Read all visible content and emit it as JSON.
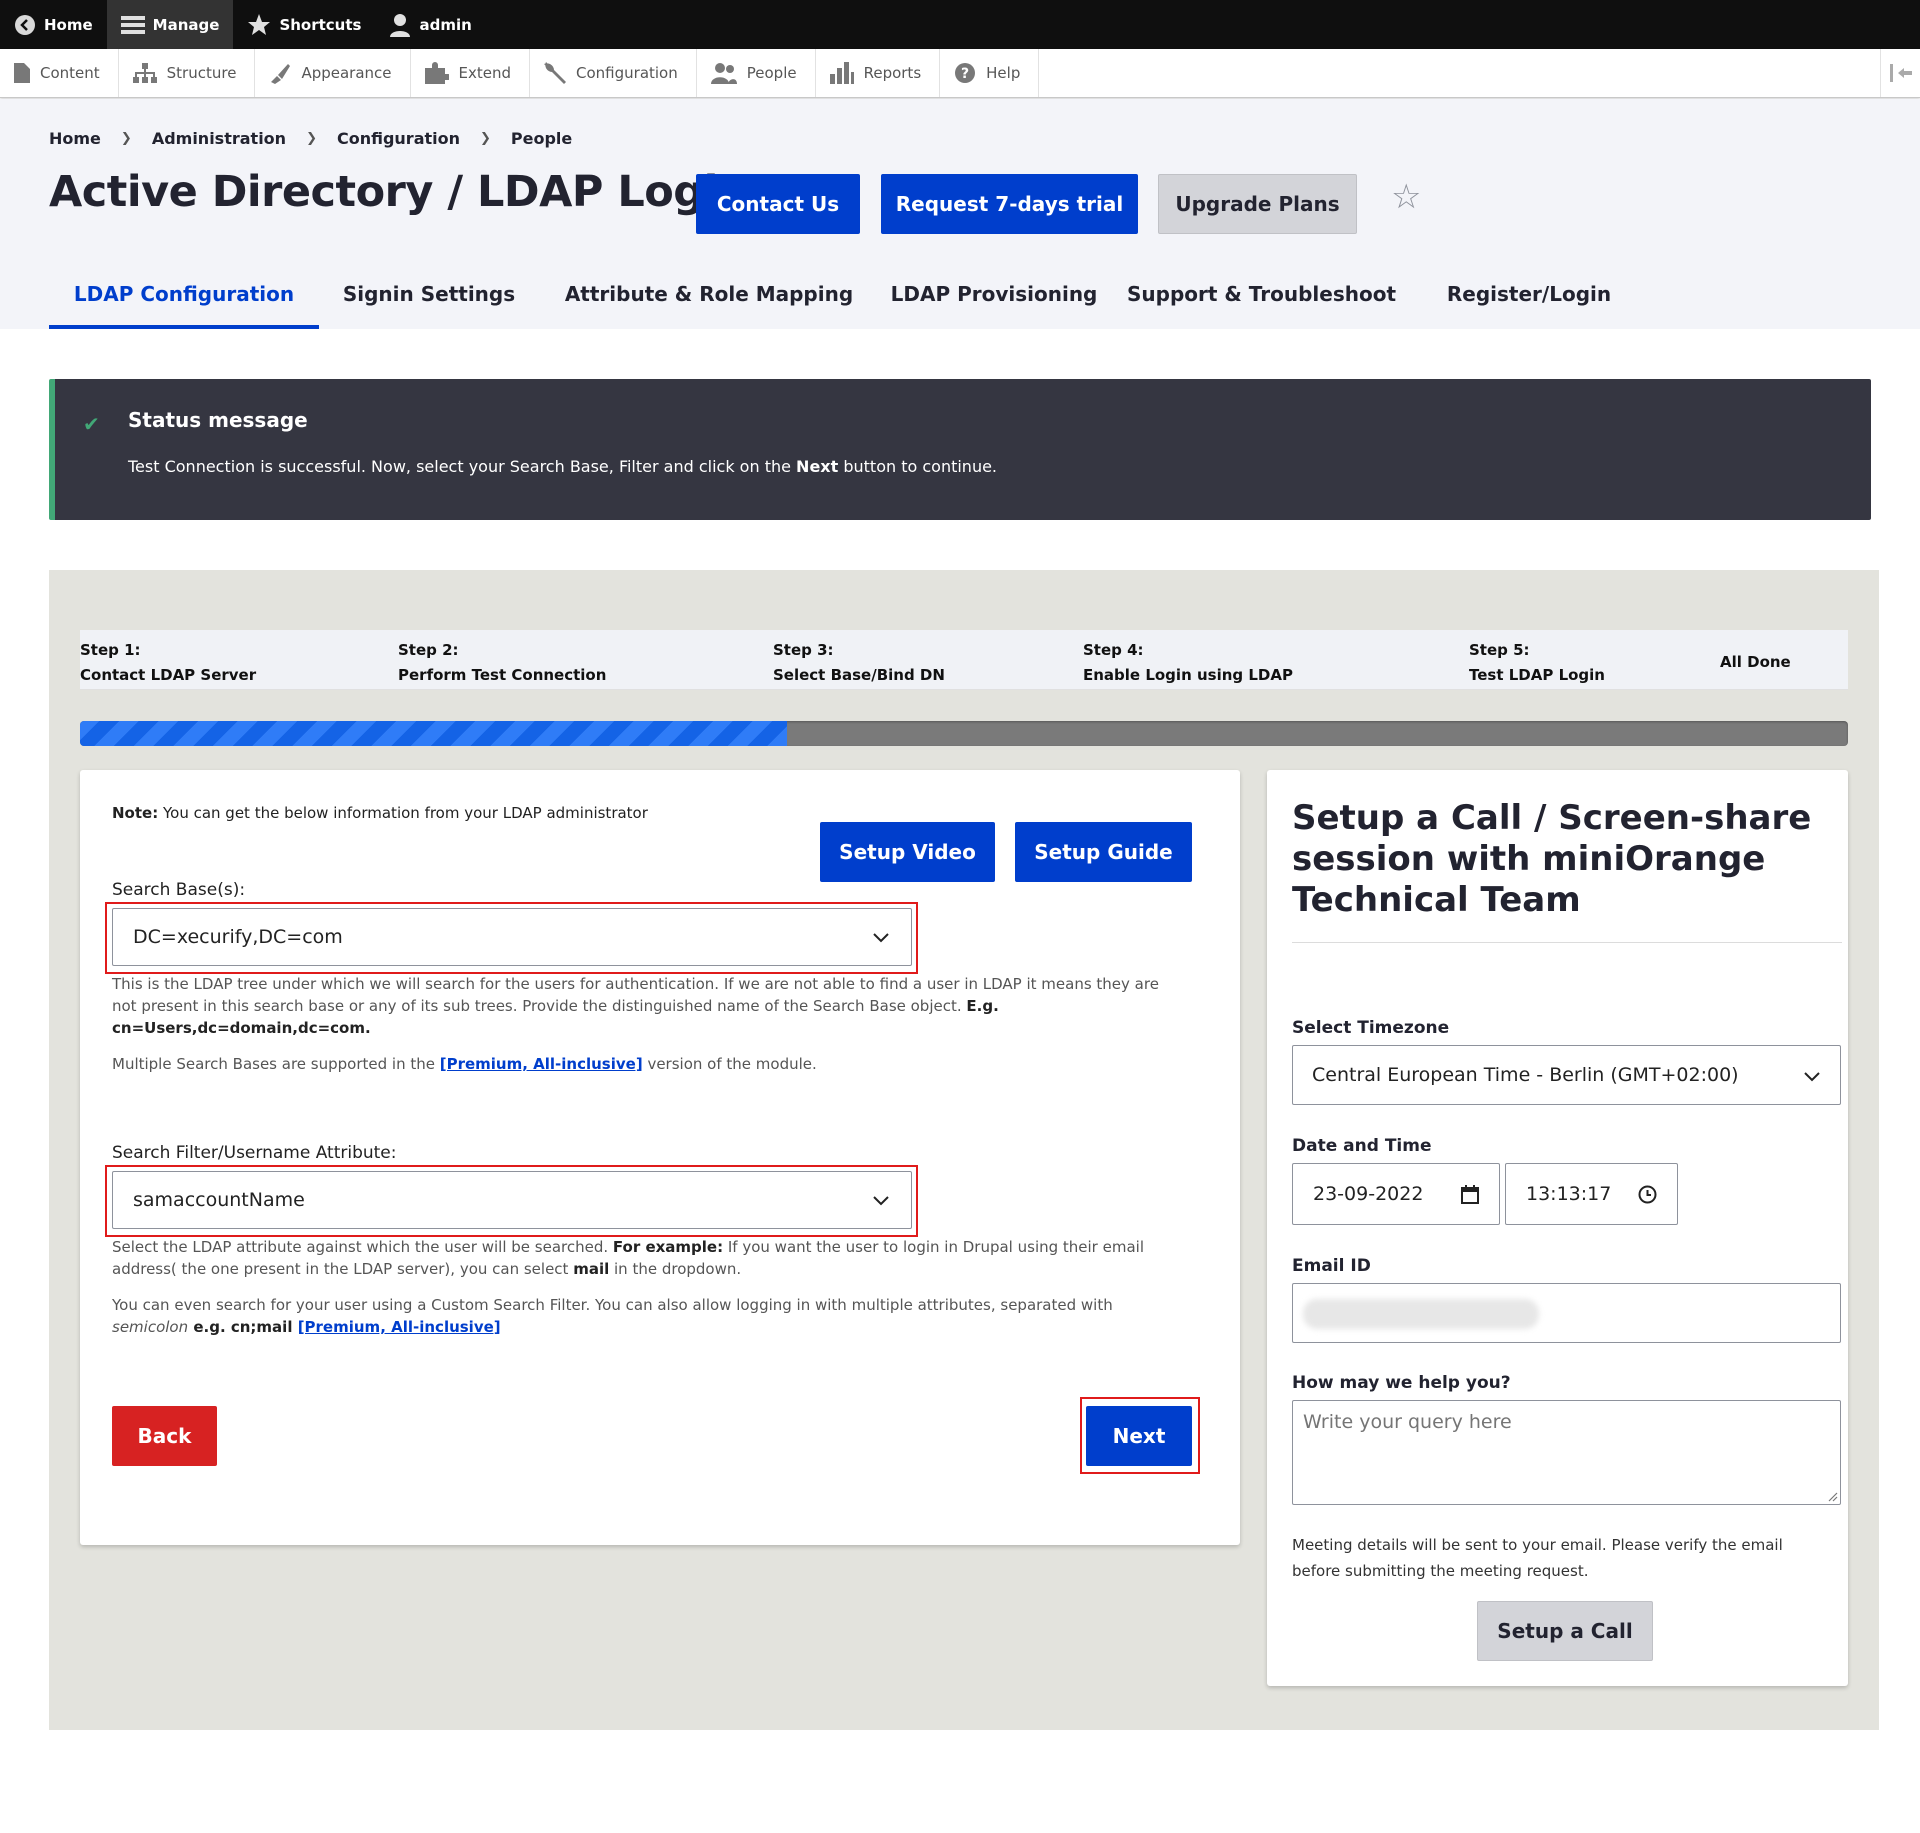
{
  "toolbar": {
    "home": "Home",
    "manage": "Manage",
    "shortcuts": "Shortcuts",
    "user": "admin"
  },
  "tray": {
    "items": [
      {
        "label": "Content",
        "icon": "file-icon"
      },
      {
        "label": "Structure",
        "icon": "sitemap-icon"
      },
      {
        "label": "Appearance",
        "icon": "paintbrush-icon"
      },
      {
        "label": "Extend",
        "icon": "puzzle-icon"
      },
      {
        "label": "Configuration",
        "icon": "wrench-icon"
      },
      {
        "label": "People",
        "icon": "people-icon"
      },
      {
        "label": "Reports",
        "icon": "bar-chart-icon"
      },
      {
        "label": "Help",
        "icon": "help-icon"
      }
    ]
  },
  "breadcrumb": [
    "Home",
    "Administration",
    "Configuration",
    "People"
  ],
  "page": {
    "title": "Active Directory / LDAP Login",
    "contact_us": "Contact Us",
    "trial": "Request 7-days trial",
    "upgrade": "Upgrade Plans"
  },
  "tabs": [
    "LDAP Configuration",
    "Signin Settings",
    "Attribute & Role Mapping",
    "LDAP Provisioning",
    "Support & Troubleshoot",
    "Register/Login"
  ],
  "status": {
    "title": "Status message",
    "text_before": "Test Connection is successful. Now, select your Search Base, Filter and click on the ",
    "text_bold": "Next",
    "text_after": " button to continue."
  },
  "steps": [
    {
      "num": "Step 1:",
      "label": "Contact LDAP Server"
    },
    {
      "num": "Step 2:",
      "label": "Perform Test Connection"
    },
    {
      "num": "Step 3:",
      "label": "Select Base/Bind DN"
    },
    {
      "num": "Step 4:",
      "label": "Enable Login using LDAP"
    },
    {
      "num": "Step 5:",
      "label": "Test LDAP Login"
    },
    {
      "num": "",
      "label": "All Done"
    }
  ],
  "progress": {
    "fraction": 0.4
  },
  "form": {
    "note_bold": "Note:",
    "note_text": " You can get the below information from your LDAP administrator",
    "setup_video": "Setup Video",
    "setup_guide": "Setup Guide",
    "search_base_label": "Search Base(s):",
    "search_base_value": "DC=xecurify,DC=com",
    "search_base_desc_1": "This is the LDAP tree under which we will search for the users for authentication. If we are not able to find a user in LDAP it means they are",
    "search_base_desc_2": "not present in this search base or any of its sub trees. Provide the distinguished name of the Search Base object. ",
    "search_base_desc_eg": "E.g.",
    "search_base_desc_3": "cn=Users,dc=domain,dc=com.",
    "multi_before": "Multiple Search Bases are supported in the ",
    "premium_link": "[Premium, All-inclusive]",
    "multi_after": " version of the module.",
    "filter_label": "Search Filter/Username Attribute:",
    "filter_value": "samaccountName",
    "filter_desc_1": "Select the LDAP attribute against which the user will be searched. ",
    "filter_desc_bold": "For example:",
    "filter_desc_2": " If you want the user to login in Drupal using their email",
    "filter_desc_3": "address( the one present in the LDAP server), you can select ",
    "filter_desc_mail": "mail",
    "filter_desc_4": " in the dropdown.",
    "custom_1": "You can even search for your user using a Custom Search Filter. You can also allow logging in with multiple attributes, separated with",
    "custom_semicolon": "semicolon",
    "custom_eg": " e.g. cn;mail ",
    "back": "Back",
    "next": "Next"
  },
  "call": {
    "title": "Setup a Call / Screen-share session with miniOrange Technical Team",
    "timezone_label": "Select Timezone",
    "timezone_value": "Central European Time - Berlin (GMT+02:00)",
    "datetime_label": "Date and Time",
    "date_value": "23-09-2022",
    "time_value": "13:13:17",
    "email_label": "Email ID",
    "help_label": "How may we help you?",
    "help_placeholder": "Write your query here",
    "note": "Meeting details will be sent to your email. Please verify the email before submitting the meeting request.",
    "button": "Setup a Call"
  }
}
